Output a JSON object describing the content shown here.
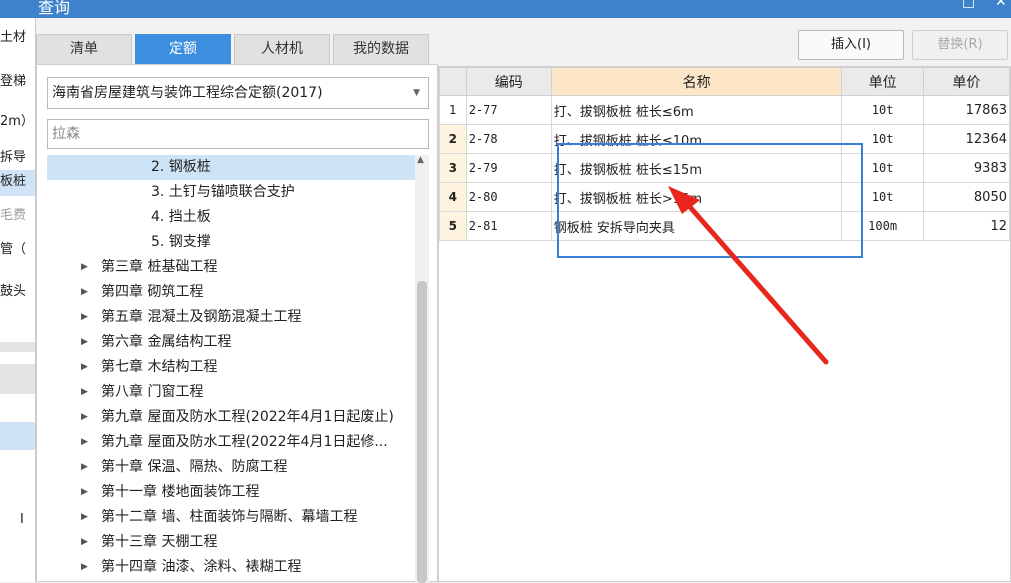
{
  "window": {
    "title": "查询",
    "restore_icon": "restore-icon",
    "close_icon": "close-icon"
  },
  "background": {
    "cells": [
      "土材",
      "登梯",
      "2m）",
      "拆导",
      "板桩",
      "毛费",
      "管（",
      "鼓头",
      "I"
    ]
  },
  "tabs": [
    {
      "label": "清单",
      "active": false
    },
    {
      "label": "定额",
      "active": true
    },
    {
      "label": "人材机",
      "active": false
    },
    {
      "label": "我的数据",
      "active": false
    }
  ],
  "buttons": {
    "insert": "插入(I)",
    "replace": "替换(R)"
  },
  "quota_library": {
    "selected": "海南省房屋建筑与装饰工程综合定额(2017)"
  },
  "search": {
    "value": "拉森"
  },
  "tree": [
    {
      "label": "2. 钢板桩",
      "level": 2,
      "selected": true,
      "expandable": false
    },
    {
      "label": "3. 土钉与锚喷联合支护",
      "level": 2,
      "selected": false,
      "expandable": false
    },
    {
      "label": "4. 挡土板",
      "level": 2,
      "selected": false,
      "expandable": false
    },
    {
      "label": "5. 钢支撑",
      "level": 2,
      "selected": false,
      "expandable": false
    },
    {
      "label": "第三章 桩基础工程",
      "level": 1,
      "selected": false,
      "expandable": true
    },
    {
      "label": "第四章 砌筑工程",
      "level": 1,
      "selected": false,
      "expandable": true
    },
    {
      "label": "第五章 混凝土及钢筋混凝土工程",
      "level": 1,
      "selected": false,
      "expandable": true
    },
    {
      "label": "第六章 金属结构工程",
      "level": 1,
      "selected": false,
      "expandable": true
    },
    {
      "label": "第七章 木结构工程",
      "level": 1,
      "selected": false,
      "expandable": true
    },
    {
      "label": "第八章 门窗工程",
      "level": 1,
      "selected": false,
      "expandable": true
    },
    {
      "label": "第九章 屋面及防水工程(2022年4月1日起废止)",
      "level": 1,
      "selected": false,
      "expandable": true
    },
    {
      "label": "第九章 屋面及防水工程(2022年4月1日起修...",
      "level": 1,
      "selected": false,
      "expandable": true
    },
    {
      "label": "第十章 保温、隔热、防腐工程",
      "level": 1,
      "selected": false,
      "expandable": true
    },
    {
      "label": "第十一章 楼地面装饰工程",
      "level": 1,
      "selected": false,
      "expandable": true
    },
    {
      "label": "第十二章 墙、柱面装饰与隔断、幕墙工程",
      "level": 1,
      "selected": false,
      "expandable": true
    },
    {
      "label": "第十三章 天棚工程",
      "level": 1,
      "selected": false,
      "expandable": true
    },
    {
      "label": "第十四章 油漆、涂料、裱糊工程",
      "level": 1,
      "selected": false,
      "expandable": true
    }
  ],
  "grid": {
    "headers": {
      "code": "编码",
      "name": "名称",
      "unit": "单位",
      "price": "单价"
    },
    "rows": [
      {
        "idx": "1",
        "code": "2-77",
        "name": "打、拔钢板桩 桩长≤6m",
        "unit": "10t",
        "price": "17863"
      },
      {
        "idx": "2",
        "code": "2-78",
        "name": "打、拔钢板桩 桩长≤10m",
        "unit": "10t",
        "price": "12364"
      },
      {
        "idx": "3",
        "code": "2-79",
        "name": "打、拔钢板桩 桩长≤15m",
        "unit": "10t",
        "price": "9383"
      },
      {
        "idx": "4",
        "code": "2-80",
        "name": "打、拔钢板桩 桩长>15m",
        "unit": "10t",
        "price": "8050"
      },
      {
        "idx": "5",
        "code": "2-81",
        "name": "钢板桩 安拆导向夹具",
        "unit": "100m",
        "price": "12"
      }
    ]
  },
  "annotation": {
    "arrow_color": "#e8261c"
  }
}
